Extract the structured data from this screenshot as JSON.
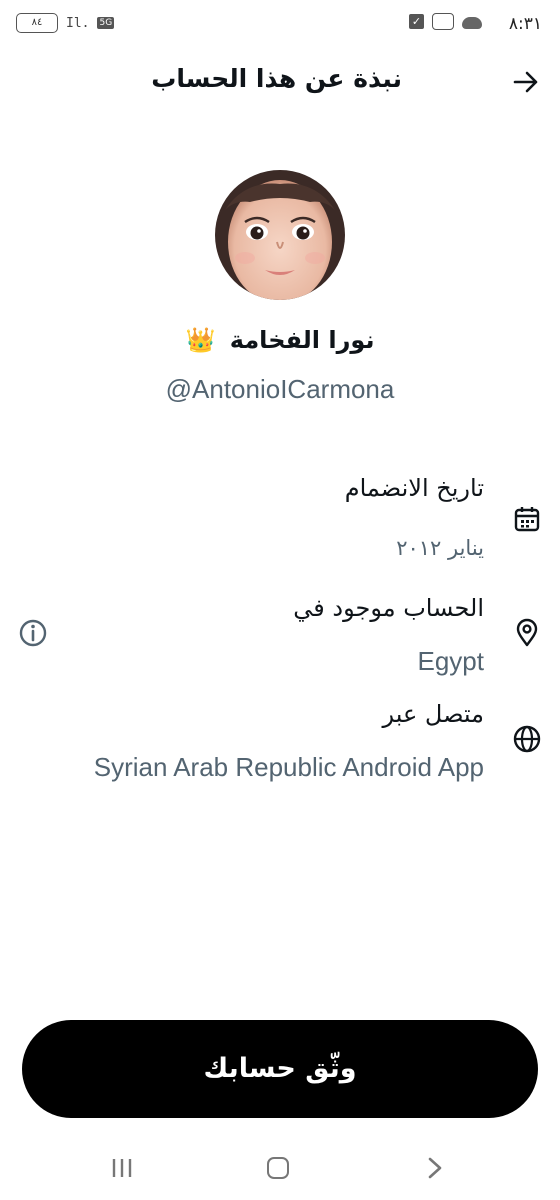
{
  "status_bar": {
    "time": "٨:٣١",
    "battery": "٨٤",
    "network": "5G",
    "app_badge": "ꜳ"
  },
  "header": {
    "title": "نبذة عن هذا الحساب",
    "back_icon": "arrow-right-icon"
  },
  "profile": {
    "display_name": "نورا الفخامة",
    "crown_emoji": "👑",
    "handle": "@AntonioICarmona"
  },
  "details": {
    "joined_label": "تاريخ الانضمام",
    "joined_value": "يناير ٢٠١٢",
    "location_label": "الحساب موجود في",
    "location_value": "Egypt",
    "connected_label": "متصل عبر",
    "connected_value": "Syrian Arab Republic Android App"
  },
  "actions": {
    "verify_label": "وثّق حسابك"
  },
  "colors": {
    "primary_text": "#0f1419",
    "secondary_text": "#536471",
    "button_bg": "#000000",
    "button_text": "#ffffff"
  }
}
